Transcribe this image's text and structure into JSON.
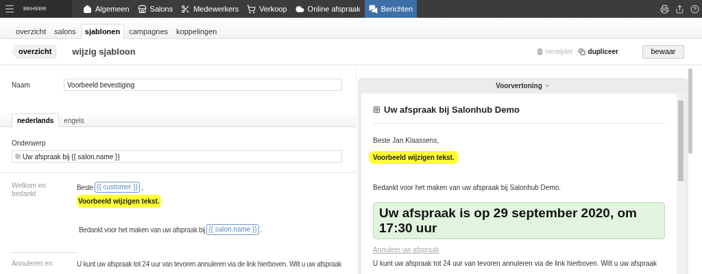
{
  "topbar": {
    "brand": "BEHEER",
    "nav": [
      {
        "kind": "home",
        "label": "Algemeen",
        "selected": false
      },
      {
        "kind": "store",
        "label": "Salons",
        "selected": false
      },
      {
        "kind": "scissors",
        "label": "Medewerkers",
        "selected": false
      },
      {
        "kind": "cart",
        "label": "Verkoop",
        "selected": false
      },
      {
        "kind": "cloud",
        "label": "Online afspraak",
        "selected": false
      },
      {
        "kind": "chat",
        "label": "Berichten",
        "selected": true
      }
    ]
  },
  "subtabs": [
    {
      "label": "overzicht",
      "selected": false
    },
    {
      "label": "salons",
      "selected": false
    },
    {
      "label": "sjablonen",
      "selected": true
    },
    {
      "label": "campagnes",
      "selected": false
    },
    {
      "label": "koppelingen",
      "selected": false
    }
  ],
  "header": {
    "back": "overzicht",
    "title": "wijzig sjabloon",
    "delete": {
      "label": "verwijder",
      "disabled": true
    },
    "duplicate": {
      "label": "dupliceer",
      "disabled": false
    },
    "save": "bewaar"
  },
  "form": {
    "name_label": "Naam",
    "name_value": "Voorbeeld bevestiging",
    "language_tabs": [
      {
        "label": "nederlands",
        "selected": true
      },
      {
        "label": "engels",
        "selected": false
      }
    ],
    "subject_label": "Onderwerp",
    "subject_value": "Uw afspraak bij {{ salon.name }}",
    "sections": [
      {
        "label": "Welkom en bedankt",
        "paragraphs": [
          {
            "kind": "plain",
            "parts": [
              {
                "kind": "text",
                "text": "Beste"
              },
              {
                "kind": "token",
                "text": "{{ customer }}"
              },
              {
                "kind": "text",
                "text": ","
              }
            ]
          },
          {
            "kind": "highlight",
            "parts": [
              {
                "kind": "text",
                "text": "Voorbeeld wijzigen tekst."
              }
            ]
          },
          {
            "kind": "plain",
            "parts": [
              {
                "kind": "text",
                "text": "Bedankt voor het maken van uw afspraak bij"
              },
              {
                "kind": "token",
                "text": "{{ salon.name }}"
              },
              {
                "kind": "text",
                "text": "."
              }
            ]
          }
        ]
      },
      {
        "label": "Annuleren en",
        "paragraphs": [
          {
            "kind": "plain",
            "parts": [
              {
                "kind": "text",
                "text": "U kunt uw afspraak tot 24 uur van tevoren annuleren via de link hierboven. Wilt u uw afspraak"
              }
            ]
          }
        ]
      }
    ]
  },
  "preview": {
    "title": "Voorvertoning",
    "items": [
      {
        "kind": "heading",
        "text": "Uw afspraak bij Salonhub Demo"
      },
      {
        "kind": "text",
        "text": "Beste Jan Klaassens,"
      },
      {
        "kind": "highlight",
        "text": "Voorbeeld wijzigen tekst."
      },
      {
        "kind": "text",
        "text": "Bedankt voor het maken van uw afspraak bij Salonhub Demo."
      },
      {
        "kind": "appointment",
        "text": "Uw afspraak is op 29 september 2020, om 17:30 uur"
      },
      {
        "kind": "link",
        "text": "Annuleer uw afspraak"
      },
      {
        "kind": "text",
        "text": "U kunt uw afspraak tot 24 uur van tevoren annuleren via de link hierboven. Wilt u uw afspraak"
      }
    ]
  }
}
